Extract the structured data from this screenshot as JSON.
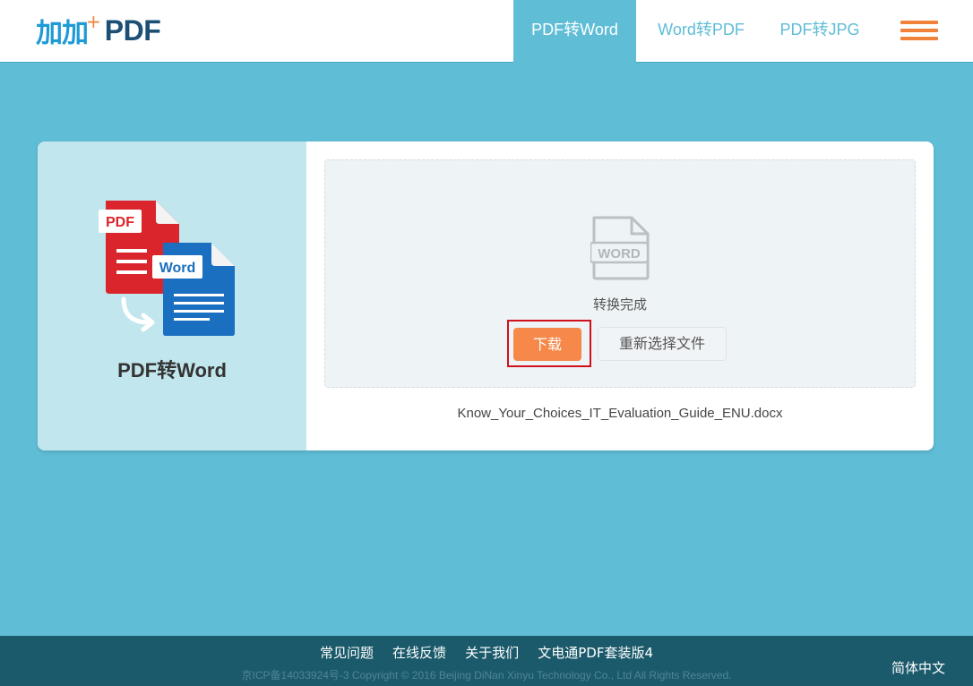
{
  "header": {
    "logo_glyph": "加加",
    "logo_pdf": "PDF",
    "tabs": [
      {
        "label": "PDF转Word",
        "active": true
      },
      {
        "label": "Word转PDF",
        "active": false
      },
      {
        "label": "PDF转JPG",
        "active": false
      }
    ]
  },
  "card": {
    "title": "PDF转Word",
    "icon_pdf_label": "PDF",
    "icon_word_label": "Word",
    "dropzone_icon_label": "WORD",
    "status": "转换完成",
    "download_label": "下载",
    "reselect_label": "重新选择文件",
    "filename": "Know_Your_Choices_IT_Evaluation_Guide_ENU.docx"
  },
  "footer": {
    "links": [
      "常见问题",
      "在线反馈",
      "关于我们",
      "文电通PDF套装版4"
    ],
    "copyright": "京ICP备14033924号-3 Copyright © 2016 Beijing DiNan Xinyu Technology Co., Ltd All Rights Reserved.",
    "language": "简体中文"
  },
  "colors": {
    "background": "#5fbdd6",
    "accent_orange": "#f6884a",
    "pdf_red": "#d9252b",
    "word_blue": "#1a6fc1",
    "footer": "#1b5a6b"
  }
}
